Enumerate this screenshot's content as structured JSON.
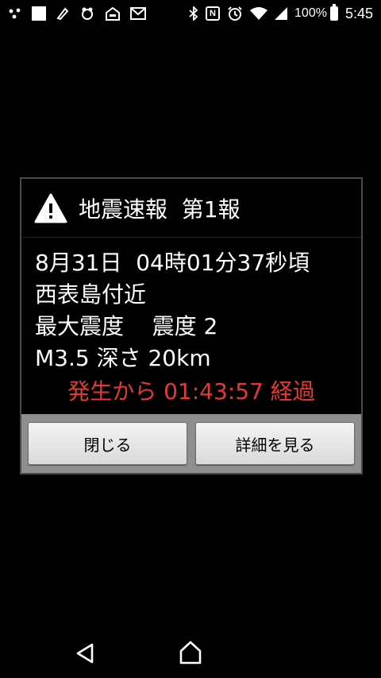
{
  "status_bar": {
    "battery_percent": "100%",
    "time": "5:45",
    "icons": [
      "dots-icon",
      "square-icon",
      "pen-icon",
      "bug-icon",
      "home-icon",
      "mail-icon",
      "bluetooth-icon",
      "nfc-icon",
      "alarm-icon",
      "wifi-icon",
      "signal-icon",
      "battery-icon"
    ],
    "nfc_label": "N"
  },
  "dialog": {
    "title": "地震速報  第1報",
    "icon": "warning-icon",
    "lines": [
      "8月31日  04時01分37秒頃",
      "西表島付近",
      "最大震度    震度 2",
      "M3.5 深さ 20km"
    ],
    "elapsed": "発生から 01:43:57 経過",
    "elapsed_color": "#e53935",
    "buttons": {
      "close": "閉じる",
      "details": "詳細を見る"
    }
  },
  "nav_bar": {
    "icons": [
      "back-icon",
      "home-icon"
    ]
  }
}
